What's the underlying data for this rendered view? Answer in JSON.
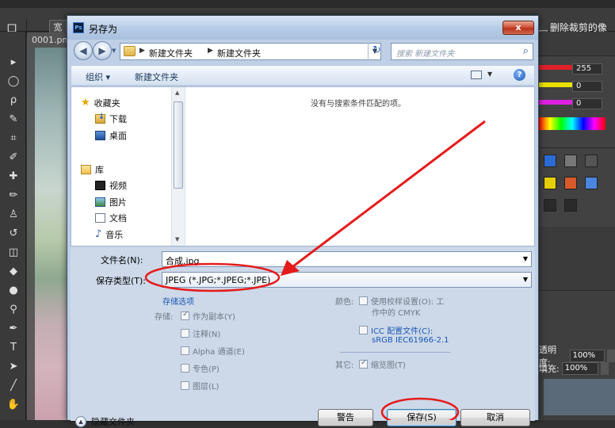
{
  "photoshop": {
    "option_bar": {
      "crop_glyph": "口",
      "ratio_partial": "宽",
      "delete_cropped": "删除裁剪的像素"
    },
    "document_tab": "0001.pn",
    "color_panel": {
      "values": [
        "255",
        "0",
        "0"
      ],
      "slider_colors": [
        "#e0202a",
        "#e8e000",
        "#e020e0"
      ]
    },
    "layers_panel": {
      "opacity_label": "透明度:",
      "opacity_value": "100%",
      "fill_label": "填充:",
      "fill_value": "100%"
    }
  },
  "dialog": {
    "title": "另存为",
    "close": "x",
    "nav": {
      "back": "◀",
      "forward": "▶",
      "breadcrumb": [
        "新建文件夹",
        "新建文件夹"
      ],
      "search_placeholder": "搜索 新建文件夹"
    },
    "commands": {
      "organize": "组织 ▾",
      "new_folder": "新建文件夹"
    },
    "nav_pane": {
      "favorites": "收藏夹",
      "downloads": "下载",
      "desktop": "桌面",
      "libraries": "库",
      "videos": "视频",
      "pictures": "图片",
      "documents": "文档",
      "music": "音乐"
    },
    "empty_message": "没有与搜索条件匹配的项。",
    "filename_label": "文件名(N):",
    "filename_value": "合成.jpg",
    "filetype_label": "保存类型(T):",
    "filetype_value": "JPEG (*.JPG;*.JPEG;*.JPE)",
    "storage_options_link": "存储选项",
    "save_group_label": "存储:",
    "options": {
      "as_copy": "作为副本(Y)",
      "notes": "注释(N)",
      "alpha": "Alpha 通道(E)",
      "spot": "专色(P)",
      "layers": "图层(L)"
    },
    "color_label": "颜色:",
    "proof_line1": "使用校样设置(O): 工",
    "proof_line2": "作中的 CMYK",
    "icc_line1": "ICC 配置文件(C):",
    "icc_line2": "sRGB IEC61966-2.1",
    "other_label": "其它:",
    "thumbnail": "缩览图(T)",
    "hide_folders": "隐藏文件夹",
    "buttons": {
      "warning": "警告",
      "save": "保存(S)",
      "cancel": "取消"
    }
  },
  "annotation_colors": {
    "arrow": "#e51b1b",
    "ellipse": "#e51b1b"
  }
}
